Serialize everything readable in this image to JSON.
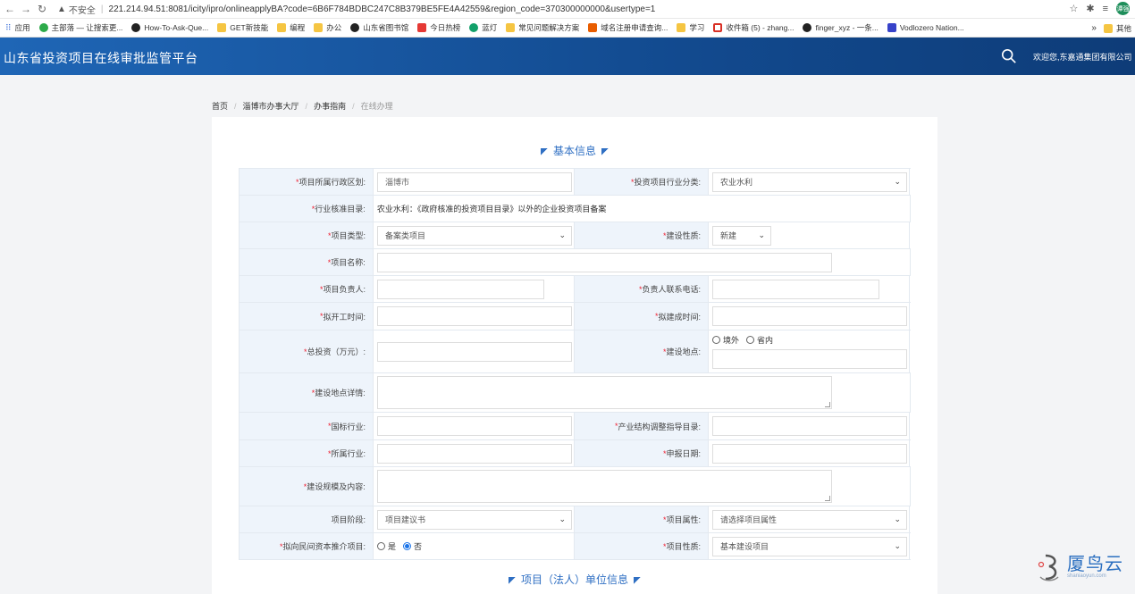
{
  "browser": {
    "insecure_label": "不安全",
    "url": "221.214.94.51:8081/icity/ipro/onlineapplyBA?code=6B6F784BDBC247C8B379BE5FE4A42559&region_code=370300000000&usertype=1",
    "profile_initials": "谭强",
    "bookmarks": [
      {
        "label": "应用",
        "icon": "apps-grid-icon"
      },
      {
        "label": "主部落 — 让搜索更...",
        "icon": "green-circle-icon"
      },
      {
        "label": "How-To-Ask-Que...",
        "icon": "github-icon"
      },
      {
        "label": "GET新技能",
        "icon": "folder-icon"
      },
      {
        "label": "编程",
        "icon": "folder-icon"
      },
      {
        "label": "办公",
        "icon": "folder-icon"
      },
      {
        "label": "山东省图书馆",
        "icon": "globe-icon"
      },
      {
        "label": "今日热榜",
        "icon": "r-icon"
      },
      {
        "label": "蓝灯",
        "icon": "lantern-icon"
      },
      {
        "label": "常见问题解决方案",
        "icon": "folder-icon"
      },
      {
        "label": "域名注册申请查询...",
        "icon": "orange-icon"
      },
      {
        "label": "学习",
        "icon": "folder-icon"
      },
      {
        "label": "收件箱 (5) - zhang...",
        "icon": "gmail-icon"
      },
      {
        "label": "finger_xyz - 一条...",
        "icon": "globe-icon"
      },
      {
        "label": "Vodlozero Nation...",
        "icon": "vl-icon"
      }
    ],
    "more_label": "»",
    "other_bookmarks": "其他"
  },
  "header": {
    "title": "山东省投资项目在线审批监管平台",
    "welcome": "欢迎您,东嘉通集团有限公司"
  },
  "breadcrumb": {
    "items": [
      "首页",
      "淄博市办事大厅",
      "办事指南"
    ],
    "current": "在线办理"
  },
  "sections": {
    "basic": "基本信息",
    "unit": "项目（法人）单位信息"
  },
  "form": {
    "region_label": "项目所属行政区划:",
    "region_value": "淄博市",
    "industry_label": "投资项目行业分类:",
    "industry_value": "农业水利",
    "catalog_label": "行业核准目录:",
    "catalog_value": "农业水利：《政府核准的投资项目目录》以外的企业投资项目备案",
    "type_label": "项目类型:",
    "type_value": "备案类项目",
    "nature_label": "建设性质:",
    "nature_value": "新建",
    "name_label": "项目名称:",
    "leader_label": "项目负责人:",
    "phone_label": "负责人联系电话:",
    "start_label": "拟开工时间:",
    "finish_label": "拟建成时间:",
    "invest_label": "总投资（万元）:",
    "location_label": "建设地点:",
    "location_opt_outside": "境外",
    "location_opt_inside": "省内",
    "location_detail_label": "建设地点详情:",
    "national_industry_label": "国标行业:",
    "structure_label": "产业结构调整指导目录:",
    "belong_industry_label": "所属行业:",
    "report_date_label": "申报日期:",
    "scale_label": "建设规模及内容:",
    "stage_label": "项目阶段:",
    "stage_value": "项目建议书",
    "attribute_label": "项目属性:",
    "attribute_value": "请选择项目属性",
    "private_label": "拟向民间资本推介项目:",
    "private_yes": "是",
    "private_no": "否",
    "project_nature_label": "项目性质:",
    "project_nature_value": "基本建设项目"
  },
  "watermark": {
    "brand": "厦鸟云",
    "domain": "shaniaoyun.com"
  }
}
